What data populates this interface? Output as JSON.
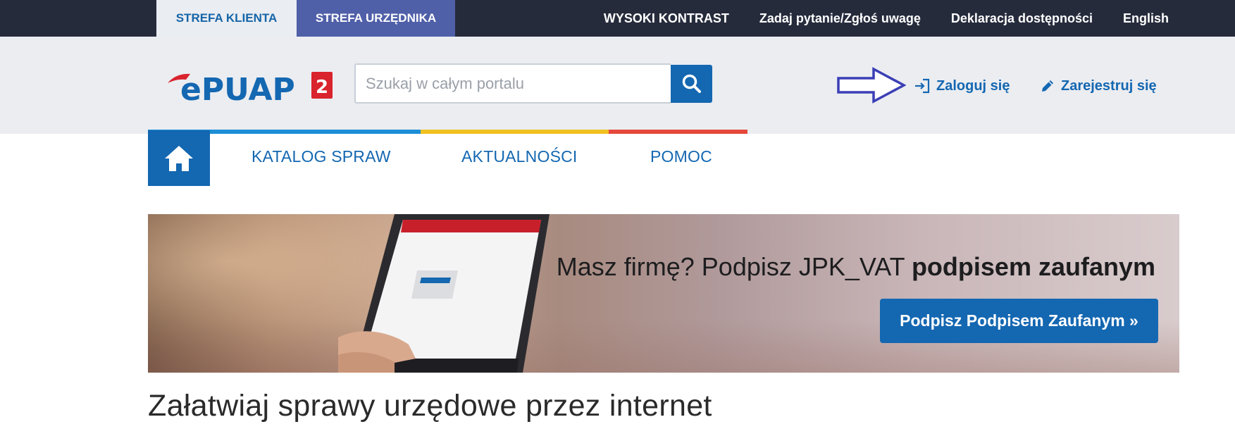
{
  "topbar": {
    "zones": {
      "client": "STREFA KLIENTA",
      "official": "STREFA URZĘDNIKA"
    },
    "links": {
      "high_contrast": "WYSOKI KONTRAST",
      "ask": "Zadaj pytanie/Zgłoś uwagę",
      "accessibility": "Deklaracja dostępności",
      "english": "English"
    }
  },
  "header": {
    "logo_text": "ePUAP",
    "logo_badge": "2",
    "search": {
      "placeholder": "Szukaj w całym portalu",
      "value": ""
    },
    "login_label": "Zaloguj się",
    "register_label": "Zarejestruj się"
  },
  "nav": {
    "items": [
      "KATALOG SPRAW",
      "AKTUALNOŚCI",
      "POMOC"
    ]
  },
  "banner": {
    "title_regular": "Masz firmę? Podpisz JPK_VAT ",
    "title_bold": "podpisem zaufanym",
    "button_label": "Podpisz Podpisem Zaufanym »"
  },
  "headline": "Załatwiaj sprawy urzędowe przez internet",
  "colors": {
    "topbar": "#262b3c",
    "accent_blue": "#1467b1",
    "official_zone": "#4f5fa8",
    "stripe_yellow": "#f0c020",
    "stripe_red": "#e5483b",
    "logo_red": "#d9232d"
  }
}
